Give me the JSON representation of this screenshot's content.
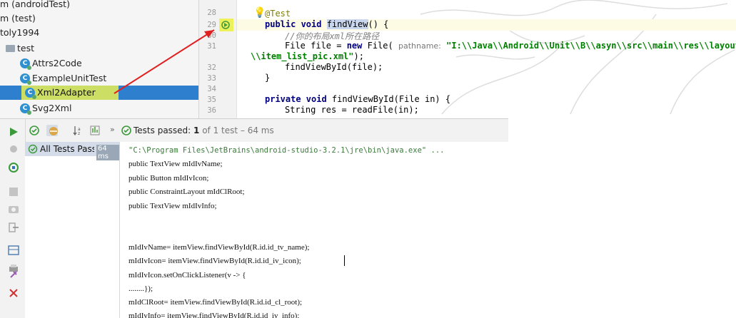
{
  "project_tree": {
    "rows": [
      {
        "label": "m (androidTest)"
      },
      {
        "label": "m (test)"
      },
      {
        "label": "toly1994"
      },
      {
        "label": "test"
      },
      {
        "label": "Attrs2Code"
      },
      {
        "label": "ExampleUnitTest"
      },
      {
        "label": "Xml2Adapter"
      },
      {
        "label": "Svg2Xml"
      }
    ]
  },
  "editor": {
    "line_numbers": [
      "28",
      "29",
      "30",
      "31",
      "",
      "32",
      "33",
      "34",
      "35",
      "36"
    ],
    "line28": "@Test",
    "line29_kw": "public void ",
    "line29_sel": "findView",
    "line29_rest": "() {",
    "line30": "//你的布局xml所在路径",
    "line31_a": "File file = ",
    "line31_kw": "new",
    "line31_b": " File( ",
    "line31_hint": "pathname:",
    "line31_str": " \"I:\\\\Java\\\\Android\\\\Unit\\\\B\\\\asyn\\\\src\\\\main\\\\res\\\\layout",
    "line31b_str": "\\\\item_list_pic.xml\"",
    "line31b_rest": ");",
    "line32": "findViewById(file);",
    "line33": "}",
    "line35_kw": "private void ",
    "line35_rest": "findViewById(File in) {",
    "line36": "String res = readFile(in);"
  },
  "run_panel": {
    "status_label": "Tests passed: ",
    "status_count": "1",
    "status_rest": " of 1 test – 64 ms",
    "tree_item": "All Tests Passed",
    "tree_time": "64 ms",
    "console_lines": [
      "\"C:\\Program Files\\JetBrains\\android-studio-3.2.1\\jre\\bin\\java.exe\" ...",
      "public TextView mIdIvName;",
      "public Button mIdIvIcon;",
      "public ConstraintLayout mIdClRoot;",
      "public TextView mIdIvInfo;",
      "",
      "",
      "mIdIvName= itemView.findViewById(R.id.id_tv_name);",
      "mIdIvIcon= itemView.findViewById(R.id.id_iv_icon);",
      "mIdIvIcon.setOnClickListener(v -> {",
      "........});",
      "mIdClRoot= itemView.findViewById(R.id.id_cl_root);",
      "mIdIvInfo= itemView.findViewById(R.id.id_iv_info);"
    ]
  },
  "colors": {
    "selection": "#2f7fcf",
    "highlight": "#f0f050",
    "arrow": "#e02020",
    "pass_green": "#3a9a3a"
  }
}
